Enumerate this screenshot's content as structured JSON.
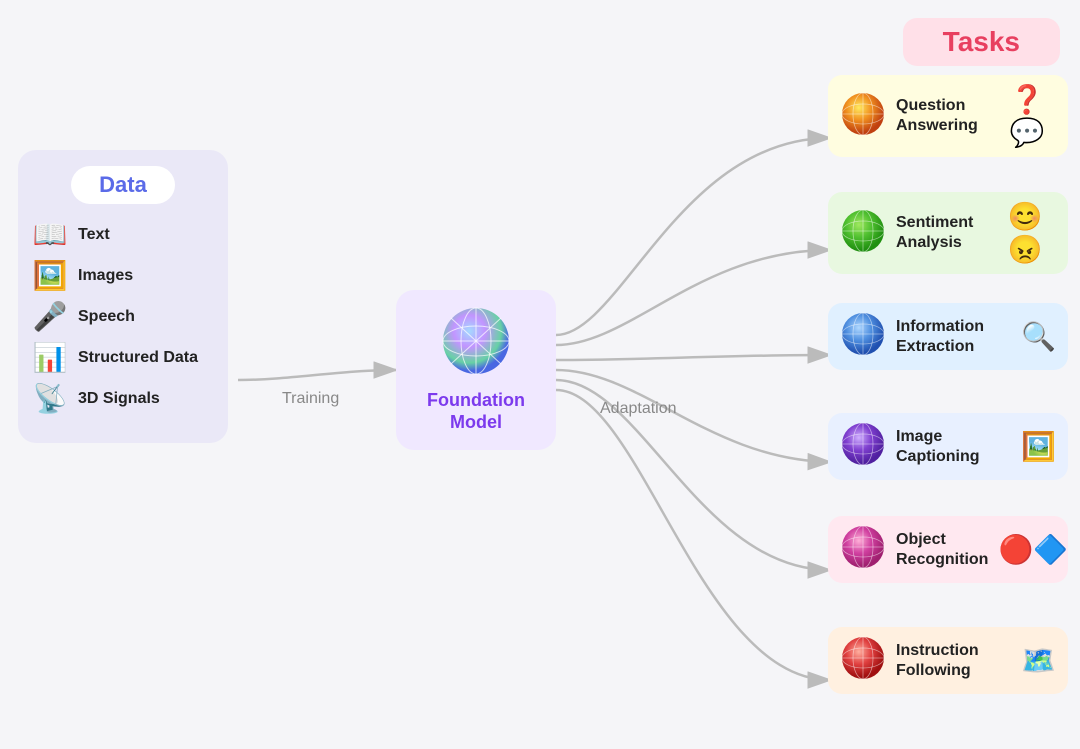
{
  "page": {
    "background": "#f5f5f8"
  },
  "data_panel": {
    "title": "Data",
    "items": [
      {
        "label": "Text",
        "emoji": "📖"
      },
      {
        "label": "Images",
        "emoji": "🖼️"
      },
      {
        "label": "Speech",
        "emoji": "🎤"
      },
      {
        "label": "Structured Data",
        "emoji": "📊"
      },
      {
        "label": "3D Signals",
        "emoji": "📡"
      }
    ]
  },
  "training": {
    "label": "Training"
  },
  "foundation_model": {
    "label": "Foundation\nModel",
    "emoji": "🌐"
  },
  "adaptation": {
    "label": "Adaptation"
  },
  "tasks": {
    "title": "Tasks",
    "items": [
      {
        "id": "qa",
        "label": "Question Answering",
        "emoji": "❓💬",
        "orb_color": "#e8a020"
      },
      {
        "id": "sa",
        "label": "Sentiment Analysis",
        "emoji": "😊",
        "orb_color": "#60c040"
      },
      {
        "id": "ie",
        "label": "Information Extraction",
        "emoji": "🔍",
        "orb_color": "#6090d8"
      },
      {
        "id": "ic",
        "label": "Image Captioning",
        "emoji": "🖼️",
        "orb_color": "#9060d8"
      },
      {
        "id": "or",
        "label": "Object Recognition",
        "emoji": "🔴🔷",
        "orb_color": "#d060a0"
      },
      {
        "id": "if",
        "label": "Instruction Following",
        "emoji": "🗺️",
        "orb_color": "#e04040"
      }
    ]
  }
}
